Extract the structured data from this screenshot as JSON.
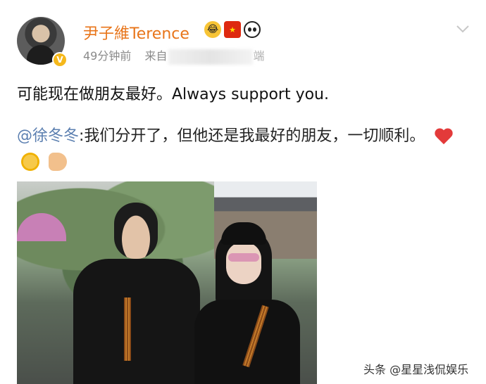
{
  "post": {
    "username": "尹子維Terence",
    "badges": [
      {
        "icon": "crying-laughing-face-icon"
      },
      {
        "icon": "china-flag-icon"
      },
      {
        "icon": "panda-icon"
      }
    ],
    "verified_badge": "V",
    "time_ago": "49分钟前",
    "source_prefix": "来自",
    "source_tail": "端",
    "content": "可能现在做朋友最好。Always support you.",
    "repost": {
      "mention": "@徐冬冬",
      "text": ":我们分开了，但他还是我最好的朋友，一切顺利。",
      "emojis": [
        "red-heart-icon",
        "sunflower-smile-icon",
        "flexed-biceps-icon"
      ]
    }
  },
  "watermark": "头条 @星星浅侃娱乐",
  "colors": {
    "username": "#e8751a",
    "mention": "#5b7fb0",
    "verified": "#f5b81b",
    "meta": "#8a8a8a"
  }
}
